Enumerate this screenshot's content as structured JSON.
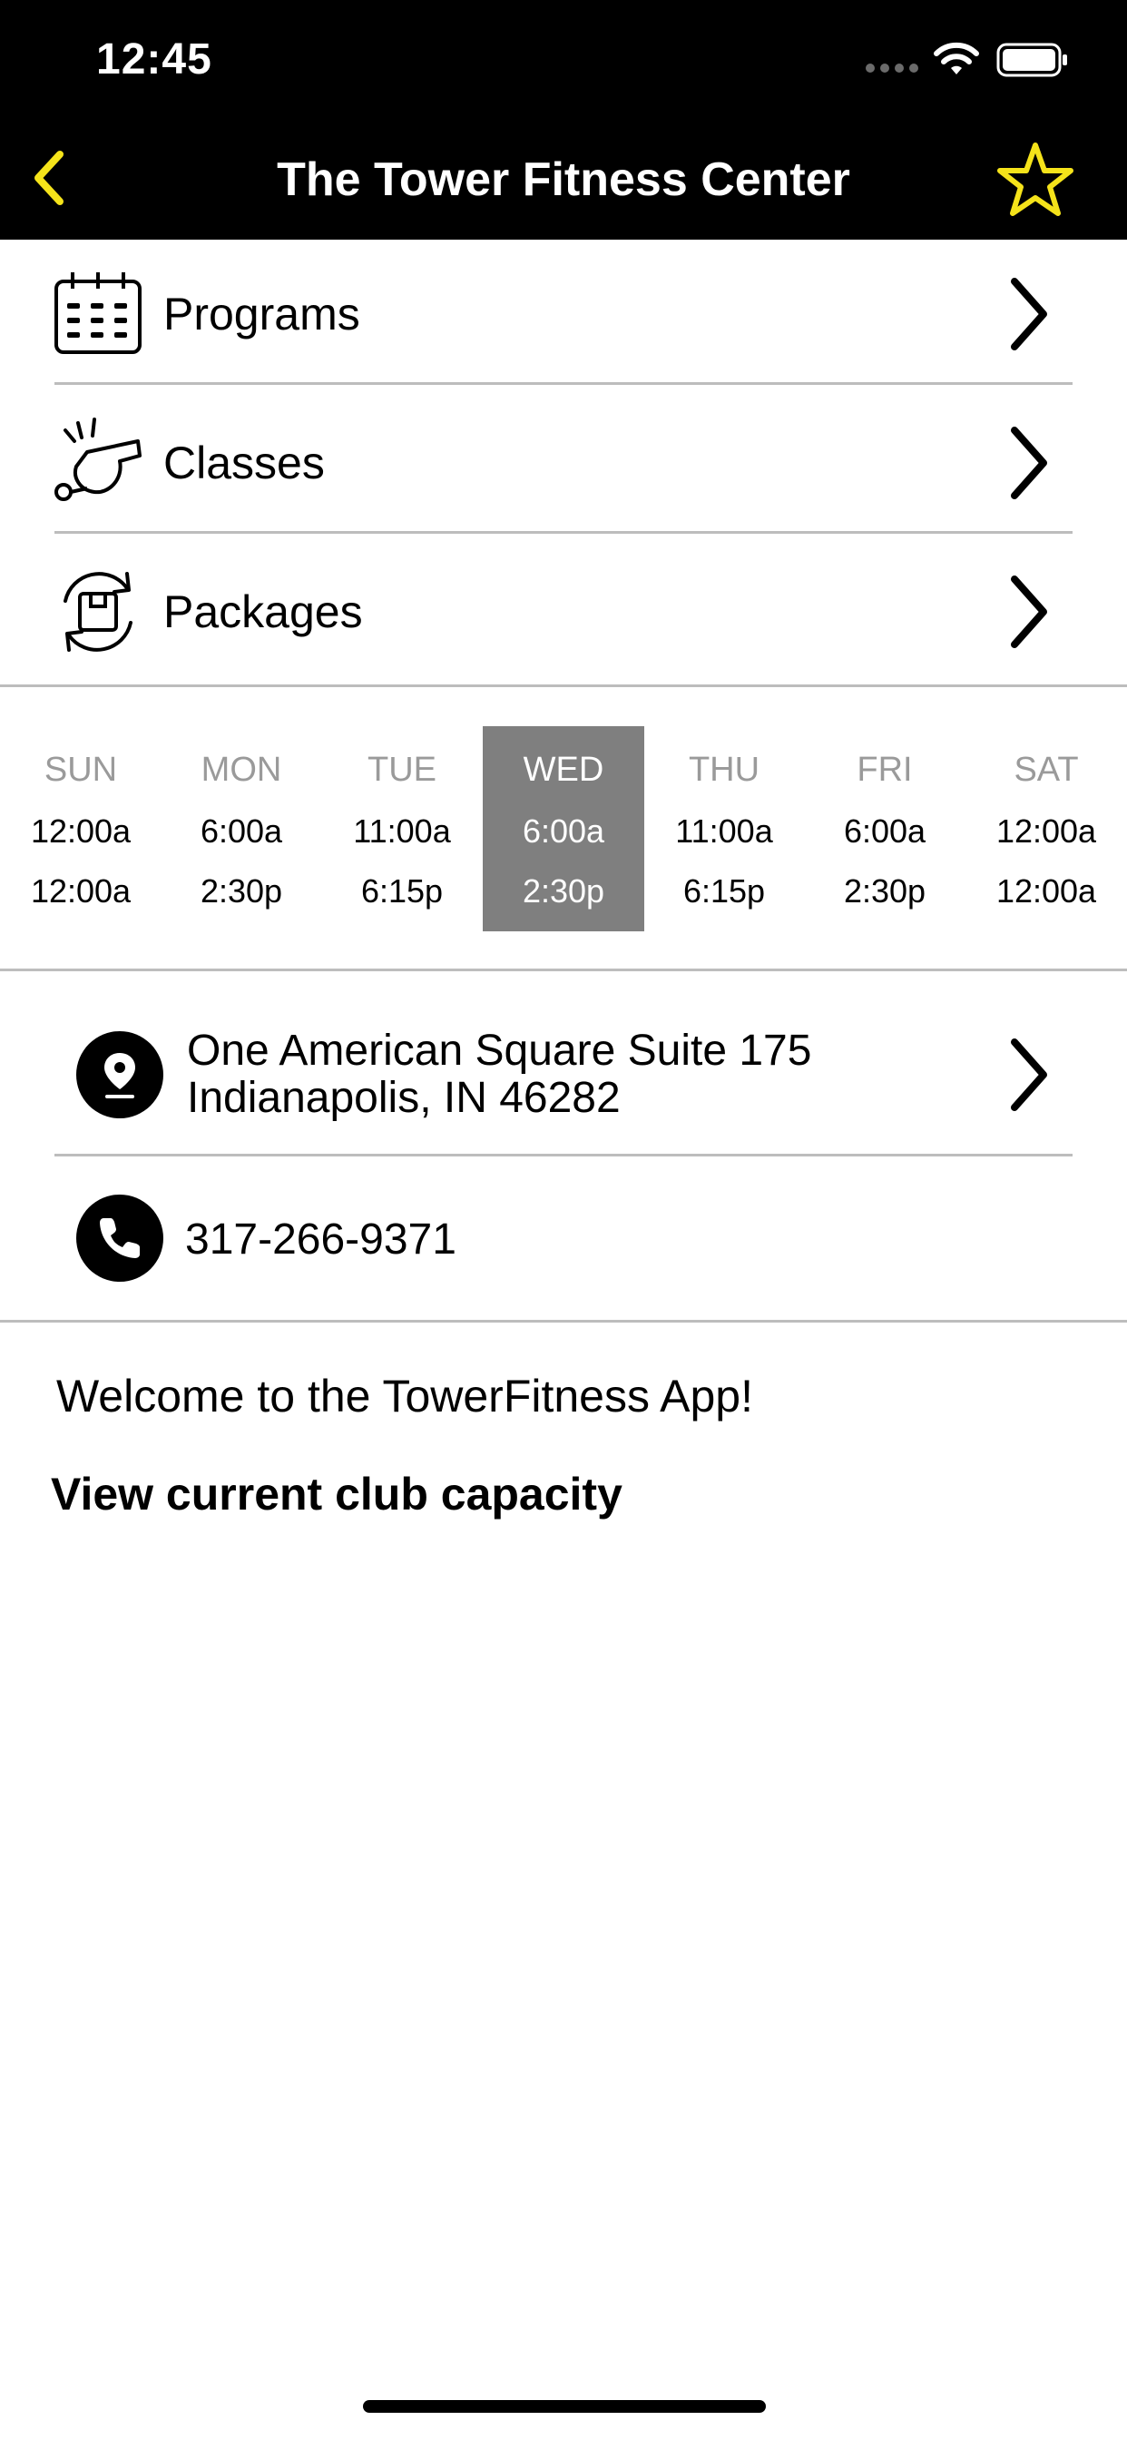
{
  "status_bar": {
    "time": "12:45"
  },
  "nav": {
    "title": "The Tower Fitness Center",
    "back_icon": "chevron-left-icon",
    "favorite_icon": "star-outline-icon",
    "accent_color": "#F5E31A"
  },
  "menu": {
    "items": [
      {
        "label": "Programs",
        "icon": "calendar-icon"
      },
      {
        "label": "Classes",
        "icon": "whistle-icon"
      },
      {
        "label": "Packages",
        "icon": "package-refresh-icon"
      }
    ]
  },
  "schedule": {
    "selected_day": "WED",
    "selected_color": "#7F7F7F",
    "days": [
      {
        "name": "SUN",
        "open": "12:00a",
        "close": "12:00a"
      },
      {
        "name": "MON",
        "open": "6:00a",
        "close": "2:30p"
      },
      {
        "name": "TUE",
        "open": "11:00a",
        "close": "6:15p"
      },
      {
        "name": "WED",
        "open": "6:00a",
        "close": "2:30p"
      },
      {
        "name": "THU",
        "open": "11:00a",
        "close": "6:15p"
      },
      {
        "name": "FRI",
        "open": "6:00a",
        "close": "2:30p"
      },
      {
        "name": "SAT",
        "open": "12:00a",
        "close": "12:00a"
      }
    ]
  },
  "contact": {
    "address_line1": "One American Square Suite 175",
    "address_line2": "Indianapolis, IN 46282",
    "address_icon": "map-pin-icon",
    "phone": "317-266-9371",
    "phone_icon": "phone-icon"
  },
  "info": {
    "welcome": "Welcome to the TowerFitness App!",
    "capacity_link": "View current club capacity"
  }
}
